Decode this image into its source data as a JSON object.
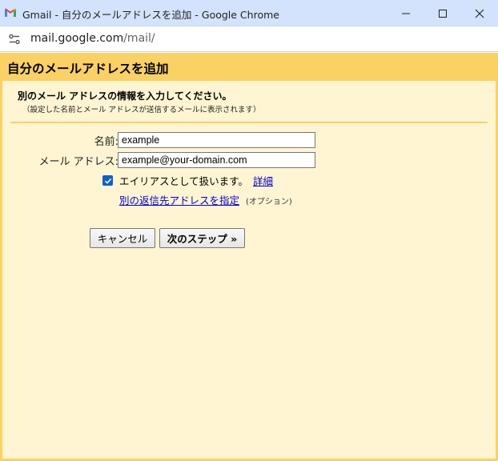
{
  "window": {
    "title": "Gmail - 自分のメールアドレスを追加 - Google Chrome",
    "minimize": "—",
    "maximize": "☐",
    "close": "✕"
  },
  "addressbar": {
    "domain": "mail.google.com",
    "path": "/mail/"
  },
  "dialog": {
    "title": "自分のメールアドレスを追加",
    "instruction": "別のメール アドレスの情報を入力してください。",
    "subnote": "（設定した名前とメール アドレスが送信するメールに表示されます）",
    "name_label": "名前:",
    "name_value": "example",
    "email_label": "メール アドレス:",
    "email_value": "example@your-domain.com",
    "alias_checked": true,
    "alias_label": "エイリアスとして扱います。",
    "detail_link": "詳細",
    "reply_to_link": "別の返信先アドレスを指定",
    "optional_note": "(オプション)",
    "cancel_button": "キャンセル",
    "next_button": "次のステップ »"
  },
  "colors": {
    "titlebar": "#d3e3fd",
    "dialog_header": "#fad163",
    "dialog_bg": "#fff5d2",
    "checkbox": "#0a61d1",
    "link": "#0000cc"
  }
}
